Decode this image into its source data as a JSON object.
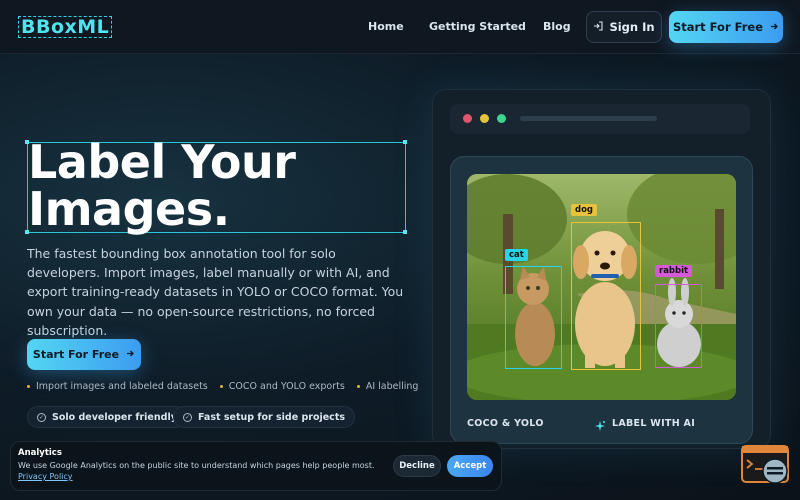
{
  "nav": {
    "logo": "BBoxML",
    "links": [
      "Home",
      "Getting Started",
      "Blog"
    ],
    "sign_in": "Sign In",
    "cta": "Start For Free"
  },
  "hero": {
    "title_line1": "Label Your",
    "title_line2": "Images.",
    "description": "The fastest bounding box annotation tool for solo developers. Import images, label manually or with AI, and export training-ready datasets in YOLO or COCO format. You own your data — no open-source restrictions, no forced subscription.",
    "cta": "Start For Free",
    "bullets": [
      "Import images and labeled datasets",
      "COCO and YOLO exports",
      "AI labelling"
    ],
    "chips": [
      "Solo developer friendly",
      "Fast setup for side projects"
    ]
  },
  "mockup": {
    "labels": [
      "cat",
      "dog",
      "rabbit"
    ],
    "features": [
      "COCO & YOLO",
      "LABEL WITH AI"
    ]
  },
  "cookie": {
    "title": "Analytics",
    "text": "We use Google Analytics on the public site to understand which pages help people most.",
    "link": "Privacy Policy",
    "decline": "Decline",
    "accept": "Accept"
  },
  "colors": {
    "accent": "#54d6f2",
    "accent2": "#3b9cf0",
    "cat_box": "#2ad3e6",
    "dog_box": "#e8c23a",
    "rabbit_box": "#d45ad8",
    "bullet_dot": "#e3b23c"
  },
  "icons": [
    "sign-in-icon",
    "arrow-right-icon",
    "check-circle-icon",
    "sparkle-icon",
    "chat-widget-icon"
  ]
}
